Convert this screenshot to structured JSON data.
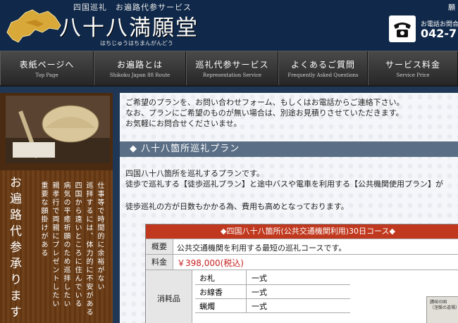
{
  "header": {
    "tagline": "四国巡礼　お遍路代参サービス",
    "title": "八十八満願堂",
    "ruby": "はちじゅうはちまんがんどう",
    "phone_label": "お電話お問合",
    "phone_number": "042-7",
    "top_right": "願"
  },
  "nav": [
    {
      "jp": "表紙ページへ",
      "en": "Top Page"
    },
    {
      "jp": "お遍路とは",
      "en": "Shikoku Japan 88 Route"
    },
    {
      "jp": "巡礼代参サービス",
      "en": "Representation Service"
    },
    {
      "jp": "よくあるご質問",
      "en": "Frequently Asked Questions"
    },
    {
      "jp": "サービス料金",
      "en": "Service Price"
    }
  ],
  "sidebar": {
    "title": "お遍路代参承ります",
    "columns": [
      "仕事等で時間的に余裕がない",
      "巡拝するには、体力的に不安がある",
      "四国から遠いところに住んでいる",
      "病気の平癒祈願のため巡拝したい",
      "親孝行で両親にプレゼントしたい",
      "重要な願掛けがある"
    ]
  },
  "main": {
    "intro": [
      "ご希望のプランを、お問い合わせフォーム、もしくはお電話からご連絡下さい。",
      "なお、プランにご希望のものが無い場合は、別途お見積りさせていただきます。",
      "お気軽にお問合せくださいませ。"
    ],
    "section_heading": "◆ 八十八箇所巡礼プラン",
    "plan_desc": [
      "四国八十八箇所を巡礼するプランです。",
      "徒歩で巡礼する【徒歩巡礼プラン】と途中バスや電車を利用する【公共機関使用プラン】が"
    ],
    "plan_note": "徒歩巡礼の方が日数もかかる為、費用も高めとなっております。",
    "course": {
      "title": "◆四国八十八箇所(公共交通機関利用)30日コース◆",
      "summary_label": "概要",
      "summary": "公共交通機関を利用する最短の巡礼コースです。",
      "price_label": "料金",
      "price": "￥398,000(税込)",
      "supplies_label": "消耗品",
      "supplies": [
        {
          "name": "お札",
          "qty": "一式"
        },
        {
          "name": "お線香",
          "qty": "一式"
        },
        {
          "name": "蝋燭",
          "qty": "一式"
        }
      ],
      "map_caption": "讃岐の国\n〔涅槃の道場〕"
    }
  },
  "colors": {
    "header_bg": "#10294a",
    "course_title_bg": "#c0391f",
    "price": "#c62121",
    "section_heading_bg": "#5a6e86"
  }
}
